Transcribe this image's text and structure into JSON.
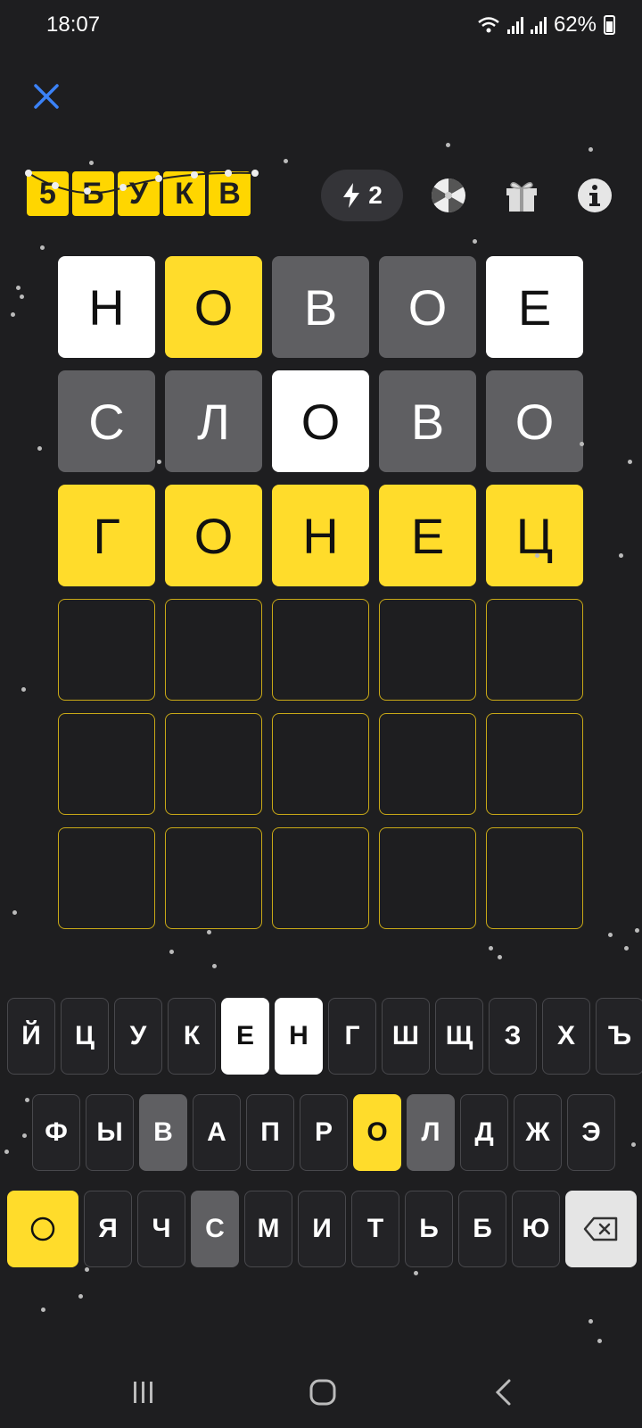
{
  "status": {
    "time": "18:07",
    "battery": "62%"
  },
  "header": {
    "logo_letters": [
      "5",
      "Б",
      "У",
      "К",
      "В"
    ],
    "hints_count": "2"
  },
  "board": {
    "rows": [
      [
        {
          "l": "Н",
          "s": "correct"
        },
        {
          "l": "О",
          "s": "present"
        },
        {
          "l": "В",
          "s": "absent"
        },
        {
          "l": "О",
          "s": "absent"
        },
        {
          "l": "Е",
          "s": "correct"
        }
      ],
      [
        {
          "l": "С",
          "s": "absent"
        },
        {
          "l": "Л",
          "s": "absent"
        },
        {
          "l": "О",
          "s": "correct"
        },
        {
          "l": "В",
          "s": "absent"
        },
        {
          "l": "О",
          "s": "absent"
        }
      ],
      [
        {
          "l": "Г",
          "s": "typed"
        },
        {
          "l": "О",
          "s": "typed"
        },
        {
          "l": "Н",
          "s": "typed"
        },
        {
          "l": "Е",
          "s": "typed"
        },
        {
          "l": "Ц",
          "s": "typed"
        }
      ],
      [
        {
          "l": "",
          "s": "empty"
        },
        {
          "l": "",
          "s": "empty"
        },
        {
          "l": "",
          "s": "empty"
        },
        {
          "l": "",
          "s": "empty"
        },
        {
          "l": "",
          "s": "empty"
        }
      ],
      [
        {
          "l": "",
          "s": "empty"
        },
        {
          "l": "",
          "s": "empty"
        },
        {
          "l": "",
          "s": "empty"
        },
        {
          "l": "",
          "s": "empty"
        },
        {
          "l": "",
          "s": "empty"
        }
      ],
      [
        {
          "l": "",
          "s": "empty"
        },
        {
          "l": "",
          "s": "empty"
        },
        {
          "l": "",
          "s": "empty"
        },
        {
          "l": "",
          "s": "empty"
        },
        {
          "l": "",
          "s": "empty"
        }
      ]
    ]
  },
  "keyboard": {
    "row1": [
      {
        "k": "Й",
        "s": ""
      },
      {
        "k": "Ц",
        "s": ""
      },
      {
        "k": "У",
        "s": ""
      },
      {
        "k": "К",
        "s": ""
      },
      {
        "k": "Е",
        "s": "correct"
      },
      {
        "k": "Н",
        "s": "correct"
      },
      {
        "k": "Г",
        "s": ""
      },
      {
        "k": "Ш",
        "s": ""
      },
      {
        "k": "Щ",
        "s": ""
      },
      {
        "k": "З",
        "s": ""
      },
      {
        "k": "Х",
        "s": ""
      },
      {
        "k": "Ъ",
        "s": ""
      }
    ],
    "row2": [
      {
        "k": "Ф",
        "s": ""
      },
      {
        "k": "Ы",
        "s": ""
      },
      {
        "k": "В",
        "s": "absent"
      },
      {
        "k": "А",
        "s": ""
      },
      {
        "k": "П",
        "s": ""
      },
      {
        "k": "Р",
        "s": ""
      },
      {
        "k": "О",
        "s": "present"
      },
      {
        "k": "Л",
        "s": "absent"
      },
      {
        "k": "Д",
        "s": ""
      },
      {
        "k": "Ж",
        "s": ""
      },
      {
        "k": "Э",
        "s": ""
      }
    ],
    "row3": [
      {
        "k": "Я",
        "s": ""
      },
      {
        "k": "Ч",
        "s": ""
      },
      {
        "k": "С",
        "s": "absent"
      },
      {
        "k": "М",
        "s": ""
      },
      {
        "k": "И",
        "s": ""
      },
      {
        "k": "Т",
        "s": ""
      },
      {
        "k": "Ь",
        "s": ""
      },
      {
        "k": "Б",
        "s": ""
      },
      {
        "k": "Ю",
        "s": ""
      }
    ]
  },
  "icons": {
    "close": "close-icon",
    "bolt": "lightning-icon",
    "wheel": "fortune-wheel-icon",
    "gift": "gift-icon",
    "info": "info-icon",
    "enter": "circle-icon",
    "backspace": "backspace-icon"
  },
  "colors": {
    "accent": "#ffdc2b",
    "absent": "#5f5f62",
    "correct": "#ffffff",
    "background": "#1e1e20",
    "close": "#3b82f6"
  }
}
